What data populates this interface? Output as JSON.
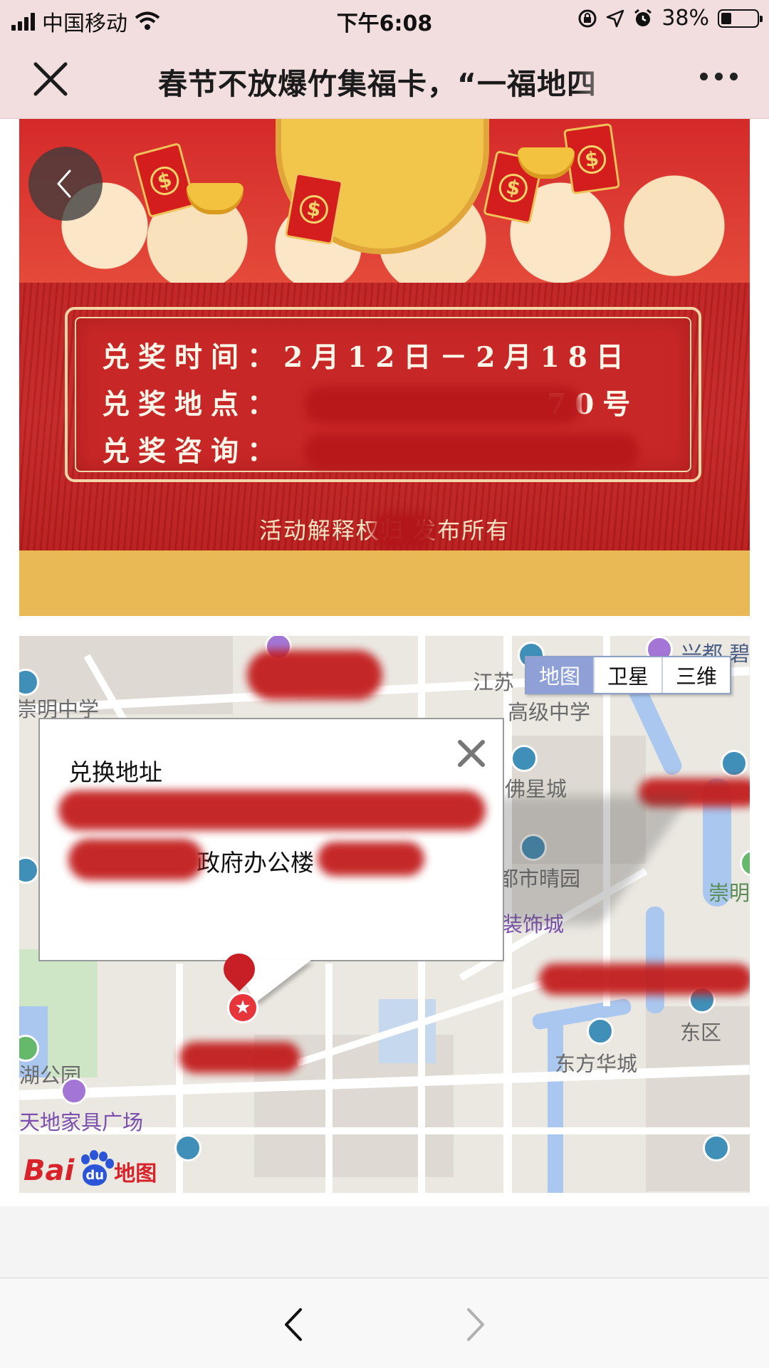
{
  "status_bar": {
    "carrier": "中国移动",
    "time": "下午6:08",
    "battery": "38%",
    "battery_level": 0.38,
    "icons": [
      "signal-icon",
      "wifi-icon",
      "rotation-lock-icon",
      "location-icon",
      "alarm-icon",
      "battery-icon"
    ]
  },
  "nav": {
    "title": "春节不放爆竹集福卡，“一福地四",
    "close_icon": "close-icon",
    "more_icon": "more-icon"
  },
  "poster": {
    "rows": [
      {
        "label": "兑奖时间：",
        "value": "2月12日－2月18日"
      },
      {
        "label": "兑奖地点：",
        "value": "70号"
      },
      {
        "label": "兑奖咨询：",
        "value": ""
      }
    ],
    "attribution": "活动解释权归      发布所有",
    "colors": {
      "primary": "#c82727",
      "gold": "#f3d6a8"
    }
  },
  "map": {
    "switch": [
      "地图",
      "卫星",
      "三维"
    ],
    "active_switch": "地图",
    "labels": {
      "jiangsu": "江苏",
      "high_school": "高级中学",
      "ming_school": "崇明中学",
      "foxing": "佛星城",
      "shiqing": "都市晴园",
      "zhuangshi": "装饰城",
      "chongming": "崇明",
      "hugongyuan": "湖公园",
      "dongqu": "东区",
      "dongfang": "东方华城",
      "jiaju": "天地家具广场",
      "xingdu": "兴都 碧"
    },
    "infowindow": {
      "title": "兑换地址",
      "address_partial": "政府办公楼"
    },
    "logo": {
      "bai": "Bai",
      "du": "du",
      "ditu": "地图"
    }
  },
  "toolbar": {
    "back_icon": "chevron-left-icon",
    "forward_icon": "chevron-right-icon"
  }
}
